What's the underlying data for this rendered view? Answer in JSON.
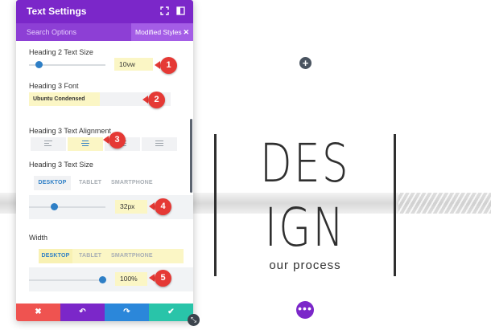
{
  "colors": {
    "accent_purple": "#7b27c9",
    "slider_blue": "#2e7fc6",
    "highlight_yellow": "#fbf6c5",
    "annotation_red": "#e53935",
    "footer_red": "#ef5350",
    "footer_purple": "#7b27c9",
    "footer_blue": "#2b87da",
    "footer_green": "#29c4a9"
  },
  "panel": {
    "title": "Text Settings",
    "search_label": "Search Options",
    "modified_styles_label": "Modified Styles",
    "header_icons": [
      "expand-icon",
      "sidebar-icon"
    ]
  },
  "fields": {
    "h2_size": {
      "label": "Heading 2 Text Size",
      "value": "10vw",
      "slider_fraction": 0.1
    },
    "h3_font": {
      "label": "Heading 3 Font",
      "value": "Ubuntu Condensed"
    },
    "h3_align": {
      "label": "Heading 3 Text Alignment",
      "options": [
        "left",
        "center",
        "right",
        "justify"
      ],
      "selected": "center"
    },
    "h3_size": {
      "label": "Heading 3 Text Size",
      "tabs": [
        "DESKTOP",
        "TABLET",
        "SMARTPHONE"
      ],
      "active_tab": "DESKTOP",
      "value": "32px",
      "slider_fraction": 0.33
    },
    "width": {
      "label": "Width",
      "tabs": [
        "DESKTOP",
        "TABLET",
        "SMARTPHONE"
      ],
      "active_tab": "DESKTOP",
      "value": "100%",
      "slider_fraction": 1.0
    }
  },
  "annotations": [
    "1",
    "2",
    "3",
    "4",
    "5"
  ],
  "footer": {
    "buttons": [
      "cancel-icon",
      "undo-icon",
      "redo-icon",
      "save-check-icon"
    ]
  },
  "preview": {
    "line1": "DES",
    "line2": "IGN",
    "subtitle": "our process"
  }
}
